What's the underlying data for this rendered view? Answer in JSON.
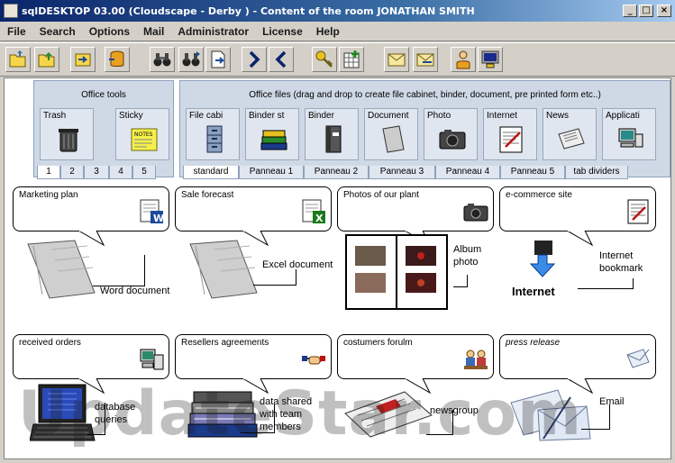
{
  "window": {
    "title": "sqlDESKTOP 03.00  (Cloudscape - Derby )  -  Content of the room   JONATHAN SMITH",
    "min_glyph": "_",
    "max_glyph": "□",
    "close_glyph": "×"
  },
  "menu": [
    "File",
    "Search",
    "Options",
    "Mail",
    "Administrator",
    "License",
    "Help"
  ],
  "toolbar": {
    "buttons": [
      "open-folder-icon",
      "up-folder-icon",
      "import-icon",
      "database-icon",
      "binoculars-icon",
      "binoculars-next-icon",
      "export-icon",
      "arrow-right-icon",
      "arrow-left-icon",
      "key-icon",
      "grid-add-icon",
      "mail-icon",
      "mail-send-icon",
      "user-icon",
      "computer-icon"
    ]
  },
  "office_tools": {
    "title": "Office tools",
    "items": [
      {
        "label": "Trash",
        "icon": "trash-icon"
      },
      {
        "label": "Sticky",
        "icon": "sticky-note-icon",
        "note_text": "NOTES"
      }
    ],
    "tabs": [
      "1",
      "2",
      "3",
      "4",
      "5"
    ],
    "active_tab": "1"
  },
  "office_files": {
    "title": "Office files (drag and drop to create file cabinet, binder, document, pre printed form etc..)",
    "items": [
      {
        "label": "File cabi",
        "icon": "file-cabinet-icon"
      },
      {
        "label": "Binder st",
        "icon": "binder-stack-icon"
      },
      {
        "label": "Binder",
        "icon": "binder-icon"
      },
      {
        "label": "Document",
        "icon": "document-icon"
      },
      {
        "label": "Photo",
        "icon": "camera-icon"
      },
      {
        "label": "Internet",
        "icon": "internet-page-icon"
      },
      {
        "label": "News",
        "icon": "newspaper-icon"
      },
      {
        "label": "Applicati",
        "icon": "application-icon"
      }
    ],
    "tabs": [
      "standard",
      "Panneau 1",
      "Panneau 2",
      "Panneau 3",
      "Panneau 4",
      "Panneau 5",
      "tab dividers"
    ],
    "active_tab": "standard"
  },
  "cards": [
    {
      "title": "Marketing plan",
      "caption": "Word document",
      "icon": "word-doc-icon",
      "object": "folder-icon"
    },
    {
      "title": "Sale forecast",
      "caption": "Excel document",
      "icon": "excel-doc-icon",
      "object": "folder-icon"
    },
    {
      "title": "Photos of our plant",
      "caption": "Album photo",
      "icon": "camera-icon",
      "object": "photo-album-icon"
    },
    {
      "title": "e-commerce site",
      "caption": "Internet bookmark",
      "icon": "internet-page-icon",
      "object": "internet-icon",
      "object_label": "Internet"
    },
    {
      "title": "received orders",
      "caption": "database queries",
      "icon": "database-app-icon",
      "object": "laptop-icon"
    },
    {
      "title": "Resellers agreements",
      "caption": "data shared with team members",
      "icon": "handshake-icon",
      "object": "binder-stack-icon"
    },
    {
      "title": "costumers forulm",
      "caption": "newsgroup",
      "icon": "forum-icon",
      "object": "newspaper-icon"
    },
    {
      "title": "press release",
      "caption": "Email",
      "icon": "envelope-icon",
      "object": "envelope-icon"
    }
  ],
  "watermark": "UpdateStar.com",
  "colors": {
    "title_gradient_start": "#0a246a",
    "panel_bg": "#cfd9e6",
    "workspace_bg": "#ffffff"
  }
}
